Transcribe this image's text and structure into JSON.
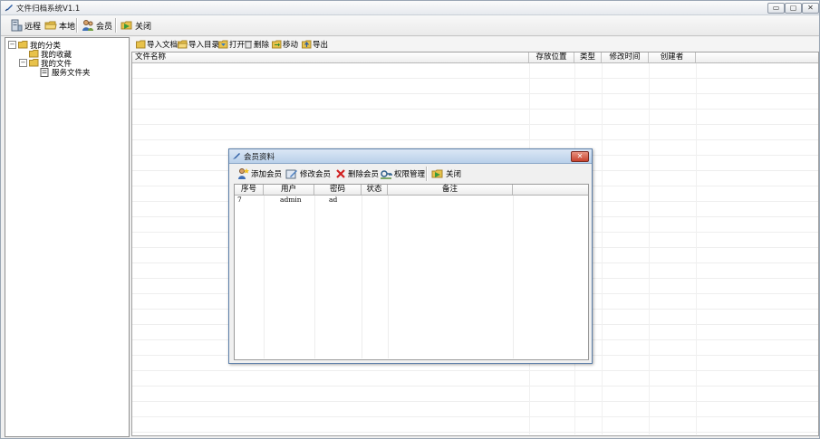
{
  "window": {
    "title": "文件归档系统V1.1",
    "controls": {
      "minimize": "▭",
      "maximize": "▢",
      "close": "✕"
    }
  },
  "toolbar": {
    "remote": "远程",
    "local": "本地",
    "members": "会员",
    "close": "关闭"
  },
  "tree": {
    "root": "我的分类",
    "favorites": "我的收藏",
    "my_files": "我的文件",
    "server_folder": "服务文件夹"
  },
  "file_toolbar": {
    "import_doc": "导入文档",
    "import_dir": "导入目录",
    "open": "打开",
    "delete": "删除",
    "move": "移动",
    "export": "导出"
  },
  "file_grid": {
    "columns": [
      "文件名称",
      "存放位置",
      "类型",
      "修改时间",
      "创建者"
    ]
  },
  "member_dialog": {
    "title": "会员资料",
    "toolbar": {
      "add": "添加会员",
      "edit": "修改会员",
      "delete": "删除会员",
      "permissions": "权限管理",
      "close": "关闭"
    },
    "columns": [
      "序号",
      "用户",
      "密码",
      "状态",
      "备注"
    ],
    "rows": [
      {
        "index": "7",
        "user": "admin",
        "password": "ad",
        "status": "",
        "note": ""
      }
    ]
  },
  "colors": {
    "folder": "#e8c24a",
    "dialog_border": "#5c7fa9",
    "close_red": "#c7432f"
  },
  "icons": {
    "app": "app-feather-icon",
    "folder": "folder-icon",
    "delete": "red-x-icon",
    "permissions": "key-icon"
  }
}
